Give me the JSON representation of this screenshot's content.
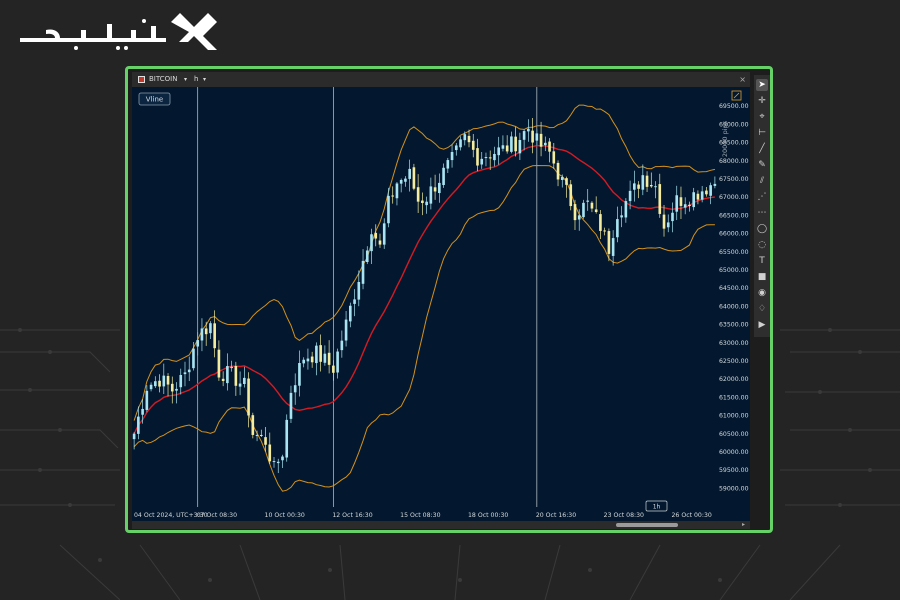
{
  "brand": {
    "logo_text": "تیوبیت"
  },
  "window": {
    "symbol": "BITCOIN",
    "timeframe": "h",
    "close_label": "×",
    "style_button": "Vline",
    "period_badge": "1h",
    "pips_label": "20000 pips"
  },
  "toolbar": {
    "tools": [
      "cursor",
      "crosshair",
      "magnet",
      "trendline",
      "line",
      "pencil",
      "channel",
      "fib",
      "brush",
      "lasso",
      "ellipse",
      "shape",
      "text",
      "rectangle",
      "eye",
      "bell",
      "play"
    ]
  },
  "colors": {
    "background": "#03182e",
    "bull_candle": "#a8e4f2",
    "bear_candle": "#f4ec9e",
    "bollinger": "#d4911c",
    "moving_average": "#d61a24",
    "frame": "#66d166"
  },
  "chart_data": {
    "type": "candlestick",
    "ylim": [
      58700,
      69800
    ],
    "y_tick_labels": [
      "69500.00",
      "69000.00",
      "68500.00",
      "68000.00",
      "67500.00",
      "67000.00",
      "66500.00",
      "66000.00",
      "65500.00",
      "65000.00",
      "64500.00",
      "64000.00",
      "63500.00",
      "63000.00",
      "62500.00",
      "62000.00",
      "61500.00",
      "61000.00",
      "60500.00",
      "60000.00",
      "59500.00",
      "59000.00"
    ],
    "x_tick_labels": [
      "04 Oct 2024, UTC+3:30",
      "07 Oct 08:30",
      "10 Oct 00:30",
      "12 Oct 16:30",
      "15 Oct 08:30",
      "18 Oct 00:30",
      "20 Oct 16:30",
      "23 Oct 08:30",
      "26 Oct 00:30"
    ],
    "x_tick_index": [
      0,
      15,
      31,
      47,
      63,
      79,
      95,
      111,
      127
    ],
    "vlines": [
      15,
      47,
      95
    ],
    "anchors": [
      [
        0,
        60500
      ],
      [
        3,
        61800
      ],
      [
        6,
        62000
      ],
      [
        9,
        61700
      ],
      [
        12,
        62100
      ],
      [
        15,
        63200
      ],
      [
        18,
        63500
      ],
      [
        20,
        62200
      ],
      [
        23,
        62100
      ],
      [
        26,
        61800
      ],
      [
        28,
        60500
      ],
      [
        31,
        60300
      ],
      [
        33,
        59500
      ],
      [
        35,
        60000
      ],
      [
        37,
        61700
      ],
      [
        40,
        62600
      ],
      [
        43,
        62700
      ],
      [
        47,
        62300
      ],
      [
        50,
        63500
      ],
      [
        53,
        64800
      ],
      [
        56,
        66200
      ],
      [
        58,
        65600
      ],
      [
        60,
        66800
      ],
      [
        62,
        67400
      ],
      [
        65,
        67600
      ],
      [
        67,
        66900
      ],
      [
        69,
        67000
      ],
      [
        72,
        67500
      ],
      [
        75,
        68000
      ],
      [
        78,
        68600
      ],
      [
        81,
        68100
      ],
      [
        84,
        68200
      ],
      [
        87,
        68300
      ],
      [
        90,
        68500
      ],
      [
        93,
        68900
      ],
      [
        95,
        68500
      ],
      [
        98,
        68200
      ],
      [
        101,
        67400
      ],
      [
        104,
        66600
      ],
      [
        107,
        66800
      ],
      [
        110,
        66200
      ],
      [
        112,
        65600
      ],
      [
        114,
        66600
      ],
      [
        117,
        67000
      ],
      [
        120,
        67600
      ],
      [
        123,
        67300
      ],
      [
        125,
        66200
      ],
      [
        128,
        66900
      ],
      [
        131,
        67000
      ],
      [
        134,
        67200
      ],
      [
        137,
        67400
      ]
    ],
    "n_candles": 138,
    "bollinger_period": 20,
    "bollinger_stddev": 2,
    "ma_period": 20
  }
}
